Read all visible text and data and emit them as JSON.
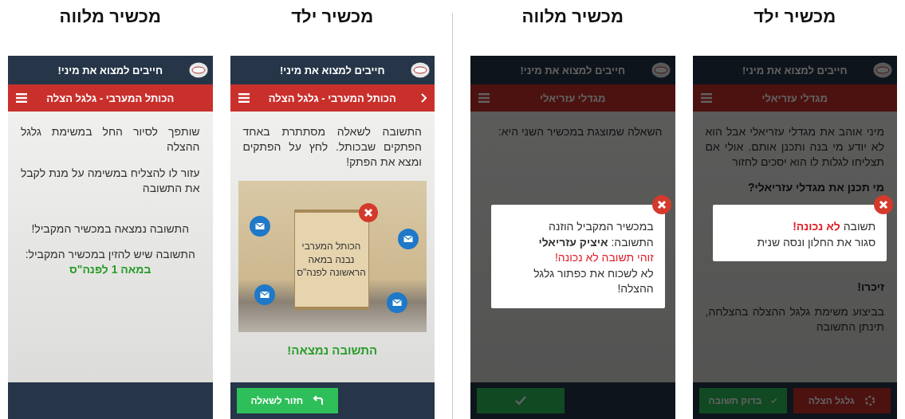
{
  "groups": [
    {
      "panels": [
        {
          "heading": "מכשיר ילד",
          "phone": {
            "app_title": "חייבים למצוא את מיני!",
            "section_title": "מגדלי עזריאלי",
            "back_button": false,
            "dimmed": true,
            "blocks": [
              {
                "kind": "paragraph",
                "text": "מיני אוהב את מגדלי עזריאלי אבל הוא לא יודע מי בנה ותכנן אותם. אולי אם תצליחו לגלות לו הוא יסכים לחזור"
              },
              {
                "kind": "question",
                "text": "מי תכנן את מגדלי עזריאלי?"
              },
              {
                "kind": "heading",
                "text": "זיכרו!"
              },
              {
                "kind": "paragraph",
                "text": "בביצוע משימת גלגל ההצלה בהצלחה, תינתן התשובה"
              }
            ],
            "popup": {
              "lines": [
                {
                  "kind": "alert",
                  "text": "תשובה **לא נכונה!**"
                },
                {
                  "kind": "normal",
                  "text": "סגור את החלון ונסה שנית"
                }
              ]
            },
            "buttons": [
              {
                "kind": "lifeline",
                "label": "גלגל הצלה"
              },
              {
                "kind": "check",
                "label": "בדוק תשובה"
              }
            ]
          }
        },
        {
          "heading": "מכשיר מלווה",
          "phone": {
            "app_title": "חייבים למצוא את מיני!",
            "section_title": "מגדלי עזריאלי",
            "back_button": false,
            "dimmed": true,
            "blocks": [
              {
                "kind": "paragraph",
                "text": "השאלה שמוצגת במכשיר השני היא:"
              }
            ],
            "popup": {
              "lines": [
                {
                  "kind": "normal",
                  "text": "במכשיר המקביל הוזנה"
                },
                {
                  "kind": "normal",
                  "text": "התשובה: **איציק עזריאלי**"
                },
                {
                  "kind": "error",
                  "text": "זוהי תשובה לא נכונה!"
                },
                {
                  "kind": "normal",
                  "text": "לא לשכוח את כפתור גלגל ההצלה!"
                }
              ]
            },
            "buttons": [
              {
                "kind": "check"
              }
            ]
          }
        }
      ]
    },
    {
      "panels": [
        {
          "heading": "מכשיר ילד",
          "phone": {
            "app_title": "חייבים למצוא את מיני!",
            "section_title": "הכותל המערבי - גלגל הצלה",
            "back_button": true,
            "dimmed": false,
            "blocks": [
              {
                "kind": "paragraph",
                "text": "התשובה לשאלה מסתתרת באחד הפתקים שבכותל. לחץ על הפתקים ומצא את הפתק!"
              },
              {
                "kind": "photo",
                "note": "הכותל המערבי נבנה במאה הראשונה לפנה\"ס"
              },
              {
                "kind": "success",
                "text": "התשובה נמצאה!"
              }
            ],
            "buttons": [
              {
                "kind": "back",
                "label": "חזור לשאלה"
              }
            ]
          }
        },
        {
          "heading": "מכשיר מלווה",
          "phone": {
            "app_title": "חייבים למצוא את מיני!",
            "section_title": "הכותל המערבי - גלגל הצלה",
            "back_button": false,
            "dimmed": false,
            "blocks": [
              {
                "kind": "paragraph",
                "text": "שותפך לסיור החל במשימת גלגל ההצלה"
              },
              {
                "kind": "paragraph",
                "text": "עזור לו להצליח במשימה על מנת לקבל את התשובה"
              },
              {
                "kind": "centered",
                "text": "התשובה נמצאה במכשיר המקביל!"
              },
              {
                "kind": "answer",
                "text": "התשובה שיש להזין במכשיר המקביל: **במאה 1 לפנה\"ס**"
              }
            ]
          }
        }
      ]
    }
  ]
}
